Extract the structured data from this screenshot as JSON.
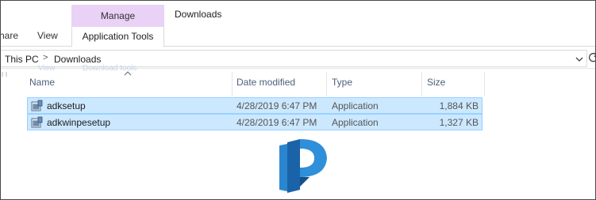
{
  "ribbon": {
    "tab_share": "Share",
    "tab_view": "View",
    "contextual_group": "Manage",
    "contextual_tab": "Application Tools",
    "window_title": "Downloads"
  },
  "address": {
    "crumbs": [
      "This PC",
      "Downloads"
    ],
    "separator": ">"
  },
  "ghost_text": [
    "View",
    "Download tools"
  ],
  "columns": {
    "name": "Name",
    "date": "Date modified",
    "type": "Type",
    "size": "Size"
  },
  "files": [
    {
      "name": "adksetup",
      "date": "4/28/2019 6:47 PM",
      "type": "Application",
      "size": "1,884 KB",
      "selected": true,
      "icon": "installer-icon"
    },
    {
      "name": "adkwinpesetup",
      "date": "4/28/2019 6:47 PM",
      "type": "Application",
      "size": "1,327 KB",
      "selected": true,
      "icon": "installer-icon"
    }
  ],
  "colors": {
    "selection_fill": "#cce8ff",
    "selection_border": "#99d1ff",
    "manage_tab": "#e9d2f5",
    "logo_blue": "#1f6fb5"
  }
}
